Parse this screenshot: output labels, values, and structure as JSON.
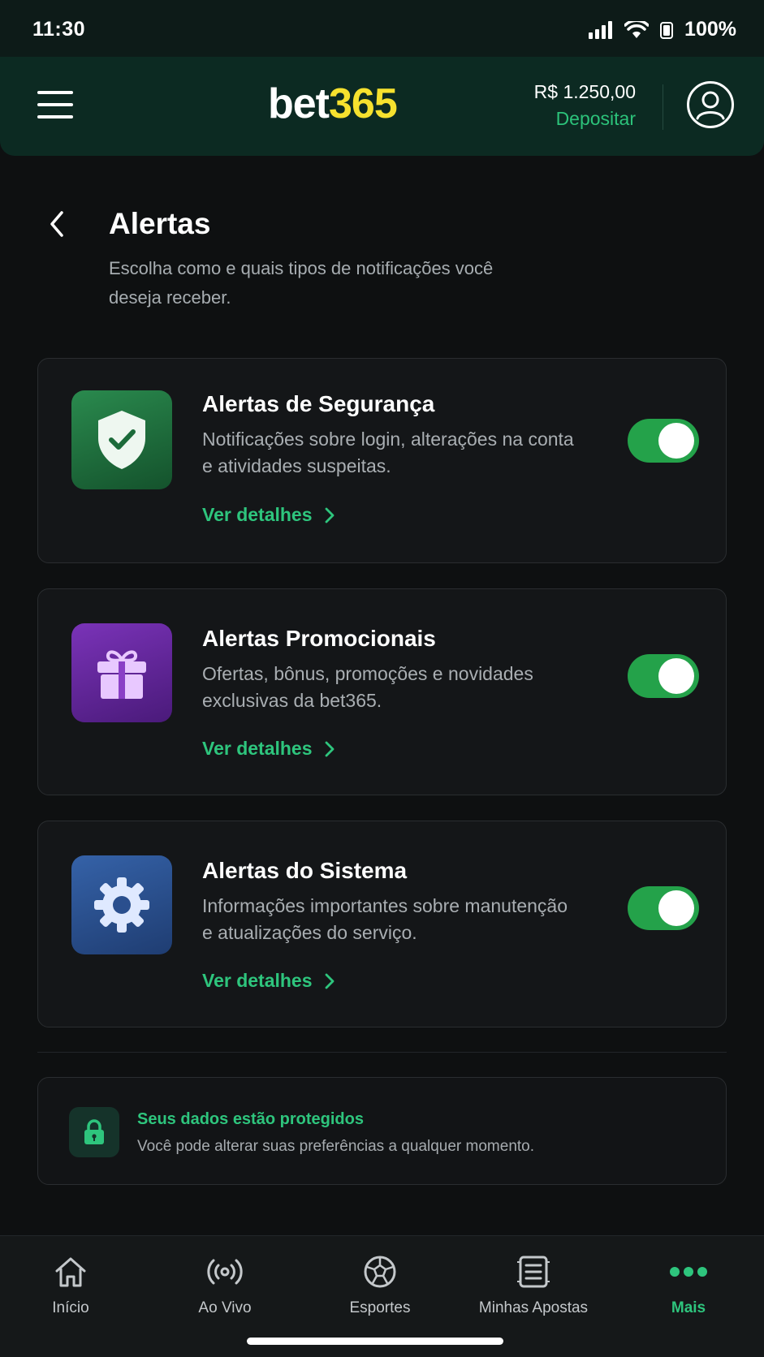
{
  "status_bar": {
    "time": "11:30",
    "battery": "100%"
  },
  "header": {
    "logo_bet": "bet",
    "logo_num": "365",
    "balance": "R$ 1.250,00",
    "deposit_label": "Depositar"
  },
  "page": {
    "title": "Alertas",
    "subtitle": "Escolha como e quais tipos de notificações você deseja receber."
  },
  "alerts": [
    {
      "icon": "shield-check-icon",
      "title": "Alertas de Segurança",
      "description": "Notificações sobre login, alterações na conta e atividades suspeitas.",
      "link": "Ver detalhes",
      "enabled": true
    },
    {
      "icon": "gift-icon",
      "title": "Alertas Promocionais",
      "description": "Ofertas, bônus, promoções e novidades exclusivas da bet365.",
      "link": "Ver detalhes",
      "enabled": true
    },
    {
      "icon": "gear-icon",
      "title": "Alertas do Sistema",
      "description": "Informações importantes sobre manutenção e atualizações do serviço.",
      "link": "Ver detalhes",
      "enabled": true
    }
  ],
  "info": {
    "title": "Seus dados estão protegidos",
    "text": "Você pode alterar suas preferências a qualquer momento."
  },
  "nav": [
    {
      "label": "Início",
      "icon": "home-icon"
    },
    {
      "label": "Ao Vivo",
      "icon": "live-icon"
    },
    {
      "label": "Esportes",
      "icon": "soccer-ball-icon"
    },
    {
      "label": "Minhas Apostas",
      "icon": "bet-slip-icon"
    },
    {
      "label": "Mais",
      "icon": "more-dots-icon",
      "active": true
    }
  ],
  "colors": {
    "accent": "#2ec57d",
    "toggle_on": "#24a24a",
    "header_bg": "#0c2a22",
    "logo_yellow": "#f6e12e"
  }
}
